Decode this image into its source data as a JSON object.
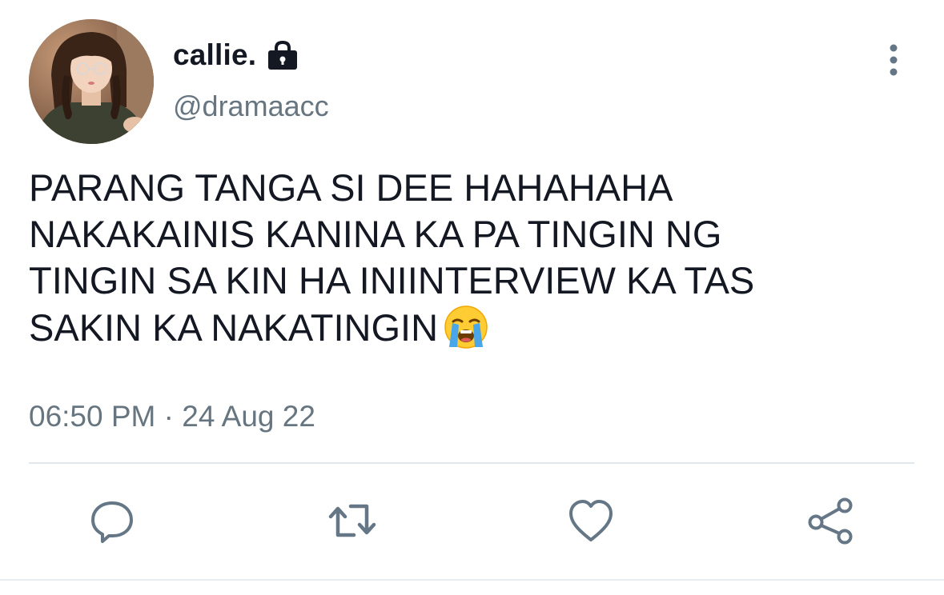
{
  "user": {
    "display_name": "callie.",
    "handle": "@dramaacc",
    "protected_icon": "lock-icon",
    "avatar": "profile-photo"
  },
  "tweet": {
    "text": "PARANG TANGA SI DEE HAHAHAHA\nNAKAKAINIS KANINA KA PA TINGIN NG\nTINGIN SA KIN HA INIINTERVIEW KA TAS\nSAKIN KA NAKATINGIN",
    "emoji": "loudly-crying-face-emoji",
    "timestamp": "06:50 PM · 24 Aug 22"
  },
  "actions": [
    {
      "name": "reply",
      "icon": "reply-icon"
    },
    {
      "name": "retweet",
      "icon": "retweet-icon"
    },
    {
      "name": "like",
      "icon": "heart-icon"
    },
    {
      "name": "share",
      "icon": "share-icon"
    }
  ],
  "menu": {
    "icon": "more-vertical-icon"
  },
  "colors": {
    "text": "#141823",
    "secondary": "#66757f",
    "icon": "#657786",
    "divider": "#e1e8ed"
  }
}
